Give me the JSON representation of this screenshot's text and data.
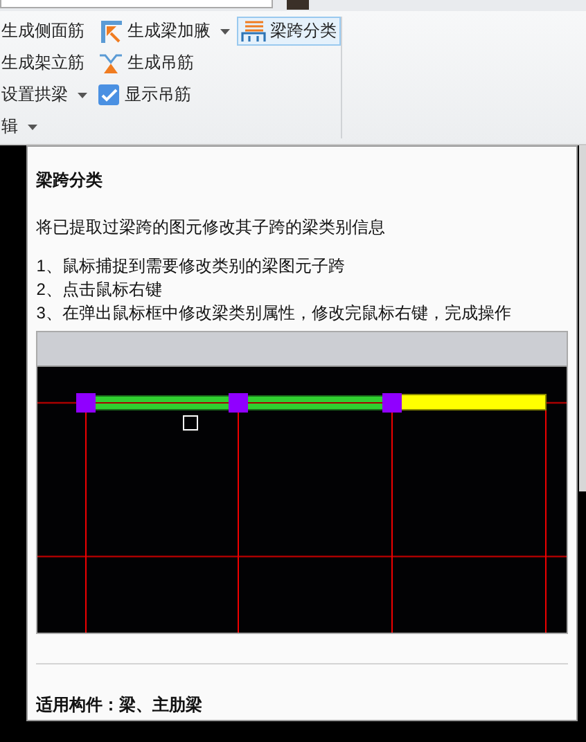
{
  "ribbon": {
    "items": [
      {
        "kind": "text",
        "label": "生成侧面筋",
        "dropdown": false,
        "selected": false
      },
      {
        "kind": "haunch",
        "label": "生成梁加腋",
        "dropdown": true,
        "selected": false
      },
      {
        "kind": "span",
        "label": "梁跨分类",
        "dropdown": false,
        "selected": true
      },
      {
        "kind": "text",
        "label": "生成架立筋",
        "dropdown": false,
        "selected": false
      },
      {
        "kind": "hanger",
        "label": "生成吊筋",
        "dropdown": false,
        "selected": false
      },
      {
        "kind": "empty"
      },
      {
        "kind": "text",
        "label": "设置拱梁",
        "dropdown": true,
        "selected": false
      },
      {
        "kind": "checkbox",
        "label": "显示吊筋",
        "checked": true
      },
      {
        "kind": "empty"
      },
      {
        "kind": "text",
        "label": "辑",
        "dropdown": true,
        "selected": false
      }
    ]
  },
  "tooltip": {
    "title": "梁跨分类",
    "description": "将已提取过梁跨的图元修改其子跨的梁类别信息",
    "steps": [
      "1、鼠标捕捉到需要修改类别的梁图元子跨",
      "2、点击鼠标右键",
      "3、在弹出鼠标框中修改梁类别属性，修改完鼠标右键，完成操作"
    ],
    "footer": "适用构件：梁、主肋梁"
  }
}
